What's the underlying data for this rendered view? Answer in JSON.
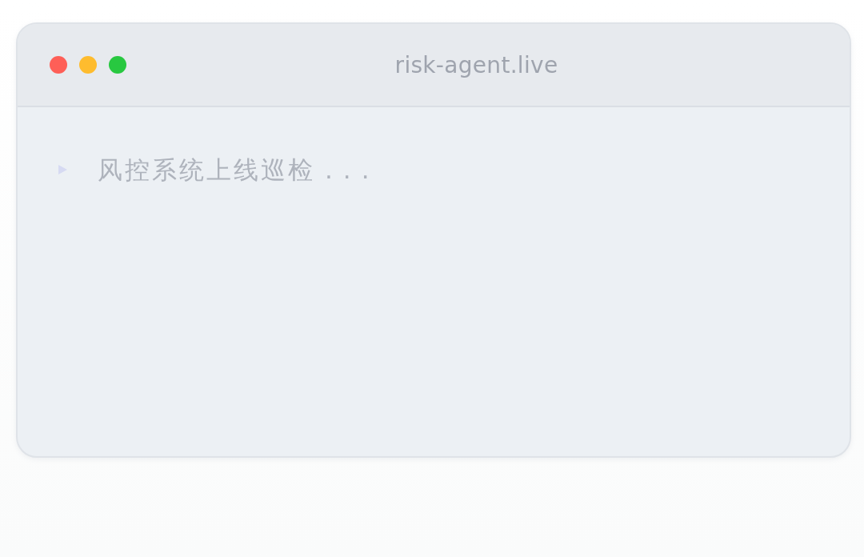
{
  "window": {
    "title": "risk-agent.live"
  },
  "terminal": {
    "lines": [
      {
        "text": "风控系统上线巡检",
        "dots": "..."
      }
    ]
  }
}
